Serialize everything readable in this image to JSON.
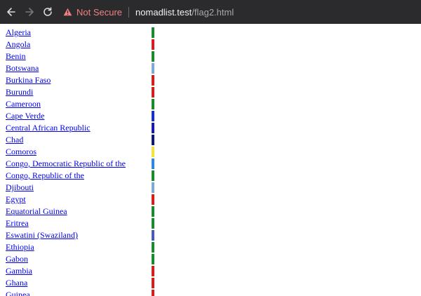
{
  "browser": {
    "security_label": "Not Secure",
    "url_host": "nomadlist.test",
    "url_path": "/flag2.html"
  },
  "countries": [
    {
      "name": "Algeria",
      "color": "#1a8a2e"
    },
    {
      "name": "Angola",
      "color": "#d41f1f"
    },
    {
      "name": "Benin",
      "color": "#1a8a2e"
    },
    {
      "name": "Botswana",
      "color": "#7fa9d0"
    },
    {
      "name": "Burkina Faso",
      "color": "#d41f1f"
    },
    {
      "name": "Burundi",
      "color": "#d41f1f"
    },
    {
      "name": "Cameroon",
      "color": "#1a8a2e"
    },
    {
      "name": "Cape Verde",
      "color": "#1a2fc8"
    },
    {
      "name": "Central African Republic",
      "color": "#1a1aa8"
    },
    {
      "name": "Chad",
      "color": "#0f1a78"
    },
    {
      "name": "Comoros",
      "color": "#f2e43a"
    },
    {
      "name": "Congo, Democratic Republic of the",
      "color": "#2f86e0"
    },
    {
      "name": "Congo, Republic of the",
      "color": "#1a8a2e"
    },
    {
      "name": "Djibouti",
      "color": "#7fa9d0"
    },
    {
      "name": "Egypt",
      "color": "#d41f1f"
    },
    {
      "name": "Equatorial Guinea",
      "color": "#1a8a2e"
    },
    {
      "name": "Eritrea",
      "color": "#1a8a2e"
    },
    {
      "name": "Eswatini (Swaziland)",
      "color": "#4a5ab8"
    },
    {
      "name": "Ethiopia",
      "color": "#1a8a2e"
    },
    {
      "name": "Gabon",
      "color": "#1a8a2e"
    },
    {
      "name": "Gambia",
      "color": "#d41f1f"
    },
    {
      "name": "Ghana",
      "color": "#d41f1f"
    },
    {
      "name": "Guinea",
      "color": "#d41f1f"
    }
  ]
}
